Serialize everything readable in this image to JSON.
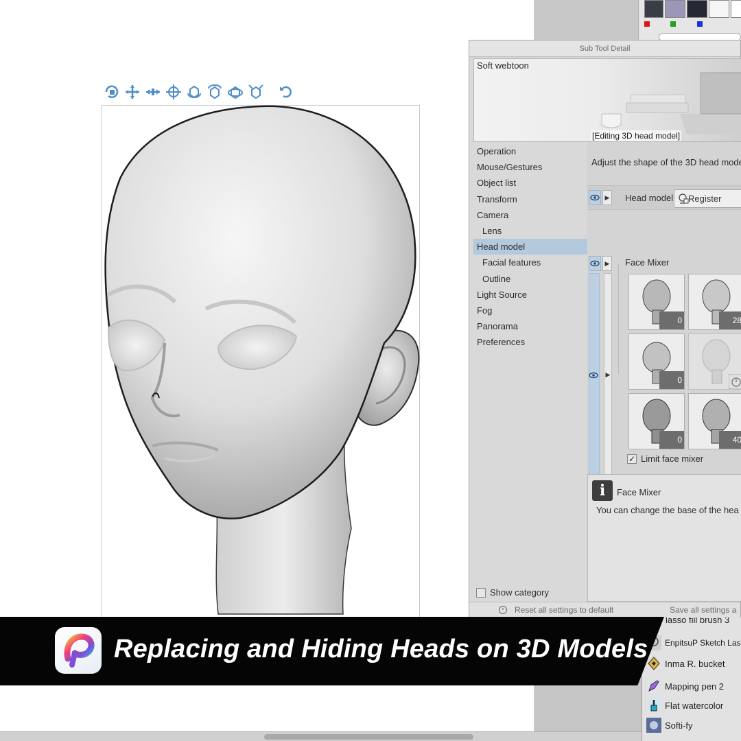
{
  "banner": {
    "title": "Replacing and Hiding Heads on 3D Models"
  },
  "sub_tool_detail": {
    "title": "Sub Tool Detail",
    "preview": {
      "title": "Soft webtoon",
      "caption": "[Editing 3D head model]"
    },
    "categories": [
      "Operation",
      "Mouse/Gestures",
      "Object list",
      "Transform",
      "Camera",
      "Lens",
      "Head model",
      "Facial features",
      "Outline",
      "Light Source",
      "Fog",
      "Panorama",
      "Preferences"
    ],
    "selected_category": "Head model",
    "show_category": "Show category",
    "description": "Adjust the shape of the 3D head mode",
    "head_model_label": "Head model",
    "register_button": "Register",
    "face_mixer_label": "Face Mixer",
    "face_mixer_values": [
      "0",
      "28",
      "0",
      "",
      "0",
      "40"
    ],
    "limit_face_mixer": "Limit face mixer",
    "info": {
      "title": "Face Mixer",
      "text": "You can change the base of the hea"
    },
    "reset_all": "Reset all settings to default",
    "save_all": "Save all settings a"
  },
  "tool_list": [
    "lasso fill brush 3",
    "EnpitsuP Sketch Lasso",
    "Inma R. bucket",
    "Mapping pen 2",
    "Flat watercolor",
    "Softi-fy"
  ],
  "palette": {
    "swatches": [
      "#3a3d45",
      "#9c96b8",
      "#262834",
      "#f6f6f6",
      "#ffffff"
    ],
    "dots": [
      "#d81818",
      "#21a021",
      "#1a30d8"
    ]
  },
  "toolbar_3d_icons": [
    "rotate-camera-icon",
    "move-camera-icon",
    "pan-camera-icon",
    "move-object-icon",
    "rotate-object-icon",
    "rotate-object-y-icon",
    "rotate-object-z-icon",
    "scale-object-icon",
    "reset-view-icon"
  ]
}
